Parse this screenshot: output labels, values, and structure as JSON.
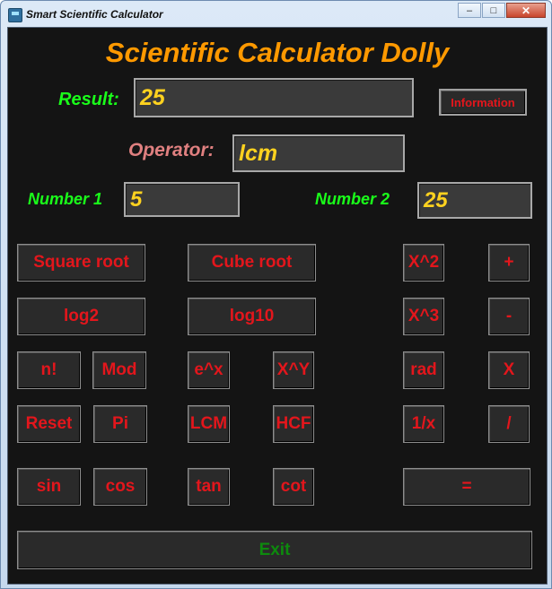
{
  "window": {
    "title": "Smart Scientific Calculator",
    "minimize": "–",
    "maximize": "□",
    "close": "✕"
  },
  "colors": {
    "background": "#141414",
    "heading": "#ff9900",
    "label_green": "#1aff1a",
    "label_pink": "#e08080",
    "value": "#ffd21f",
    "button_text": "#e3161c",
    "exit_text": "#0d8a0d"
  },
  "heading": "Scientific Calculator Dolly",
  "result": {
    "label": "Result:",
    "value": "25"
  },
  "info_button": "Information",
  "operator": {
    "label": "Operator:",
    "value": "lcm"
  },
  "number1": {
    "label": "Number 1",
    "value": "5"
  },
  "number2": {
    "label": "Number 2",
    "value": "25"
  },
  "buttons": {
    "square_root": "Square root",
    "cube_root": "Cube root",
    "x_squared": "X^2",
    "plus": "+",
    "log2": "log2",
    "log10": "log10",
    "x_cubed": "X^3",
    "minus": "-",
    "factorial": "n!",
    "mod": "Mod",
    "e_power_x": "e^x",
    "x_power_y": "X^Y",
    "rad": "rad",
    "multiply": "X",
    "reset": "Reset",
    "pi": "Pi",
    "lcm": "LCM",
    "hcf": "HCF",
    "reciprocal": "1/x",
    "divide": "/",
    "sin": "sin",
    "cos": "cos",
    "tan": "tan",
    "cot": "cot",
    "equals": "=",
    "exit": "Exit"
  }
}
